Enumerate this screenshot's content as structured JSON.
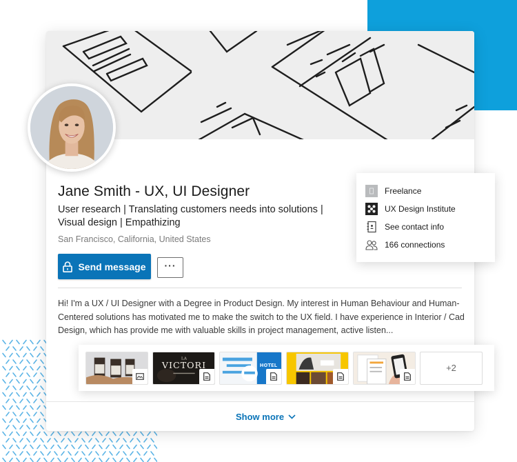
{
  "profile": {
    "name_title": "Jane Smith -  UX, UI Designer",
    "headline_line1": "User research  | Translating customers needs into solutions  |",
    "headline_line2": "Visual design  |  Empathizing",
    "location": "San Francisco, California, United States",
    "summary": "Hi! I'm a UX / UI Designer with a Degree in Product Design. My interest in Human Behaviour and Human-Centered solutions has motivated me to make the switch to the UX field. I have experience in Interior / Cad Design, which has provide me with valuable skills in project management, active listen..."
  },
  "actions": {
    "send_message_label": "Send message",
    "send_message_icon": "lock-icon",
    "more_label": "···",
    "more_icon": "more-options-icon"
  },
  "info_panel": {
    "items": [
      {
        "label": "Freelance",
        "icon": "company-icon"
      },
      {
        "label": "UX Design Institute",
        "icon": "school-icon"
      },
      {
        "label": "See contact info",
        "icon": "contact-book-icon"
      },
      {
        "label": "166 connections",
        "icon": "connections-icon"
      }
    ]
  },
  "media": {
    "items": [
      {
        "name": "packaging-project",
        "type_icon": "image-icon"
      },
      {
        "name": "la-victoria-restaurant",
        "type_icon": "document-icon"
      },
      {
        "name": "hotel-website",
        "type_icon": "document-icon"
      },
      {
        "name": "yellow-website",
        "type_icon": "document-icon"
      },
      {
        "name": "mobile-app",
        "type_icon": "document-icon"
      }
    ],
    "more_label": "+2"
  },
  "footer": {
    "show_more_label": "Show more",
    "show_more_icon": "chevron-down-icon"
  },
  "colors": {
    "accent_blue": "#0a74b8",
    "decor_blue": "#0ea0dc",
    "pattern_blue": "#5bb4e6"
  }
}
